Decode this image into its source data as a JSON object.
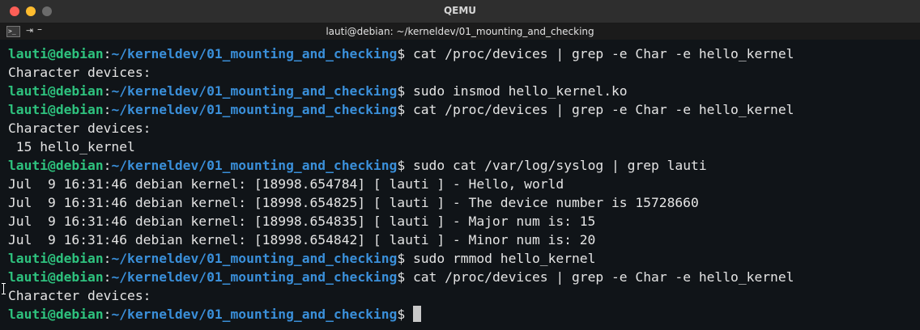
{
  "window": {
    "app_title": "QEMU",
    "terminal_title": "lauti@debian: ~/kerneldev/01_mounting_and_checking"
  },
  "prompt": {
    "user_host": "lauti@debian",
    "sep": ":",
    "path": "~/kerneldev/01_mounting_and_checking",
    "dollar": "$ "
  },
  "lines": [
    {
      "type": "prompt",
      "cmd": "cat /proc/devices | grep -e Char -e hello_kernel"
    },
    {
      "type": "output",
      "text": "Character devices:"
    },
    {
      "type": "prompt",
      "cmd": "sudo insmod hello_kernel.ko"
    },
    {
      "type": "prompt",
      "cmd": "cat /proc/devices | grep -e Char -e hello_kernel"
    },
    {
      "type": "output",
      "text": "Character devices:"
    },
    {
      "type": "output",
      "text": " 15 hello_kernel"
    },
    {
      "type": "prompt",
      "cmd": "sudo cat /var/log/syslog | grep lauti"
    },
    {
      "type": "output",
      "text": "Jul  9 16:31:46 debian kernel: [18998.654784] [ lauti ] - Hello, world"
    },
    {
      "type": "output",
      "text": "Jul  9 16:31:46 debian kernel: [18998.654825] [ lauti ] - The device number is 15728660"
    },
    {
      "type": "output",
      "text": "Jul  9 16:31:46 debian kernel: [18998.654835] [ lauti ] - Major num is: 15"
    },
    {
      "type": "output",
      "text": "Jul  9 16:31:46 debian kernel: [18998.654842] [ lauti ] - Minor num is: 20"
    },
    {
      "type": "prompt",
      "cmd": "sudo rmmod hello_kernel"
    },
    {
      "type": "prompt",
      "cmd": "cat /proc/devices | grep -e Char -e hello_kernel"
    },
    {
      "type": "output",
      "text": "Character devices:"
    },
    {
      "type": "prompt",
      "cmd": "",
      "cursor": true
    }
  ],
  "colors": {
    "user_host": "#2ec27e",
    "path": "#3a8fd9",
    "text": "#e4e4e4",
    "background": "#101418"
  },
  "icons": [
    "terminal-icon",
    "pin-icon",
    "minimize-icon",
    "close-icon",
    "minimize-traffic-icon",
    "maximize-icon"
  ]
}
